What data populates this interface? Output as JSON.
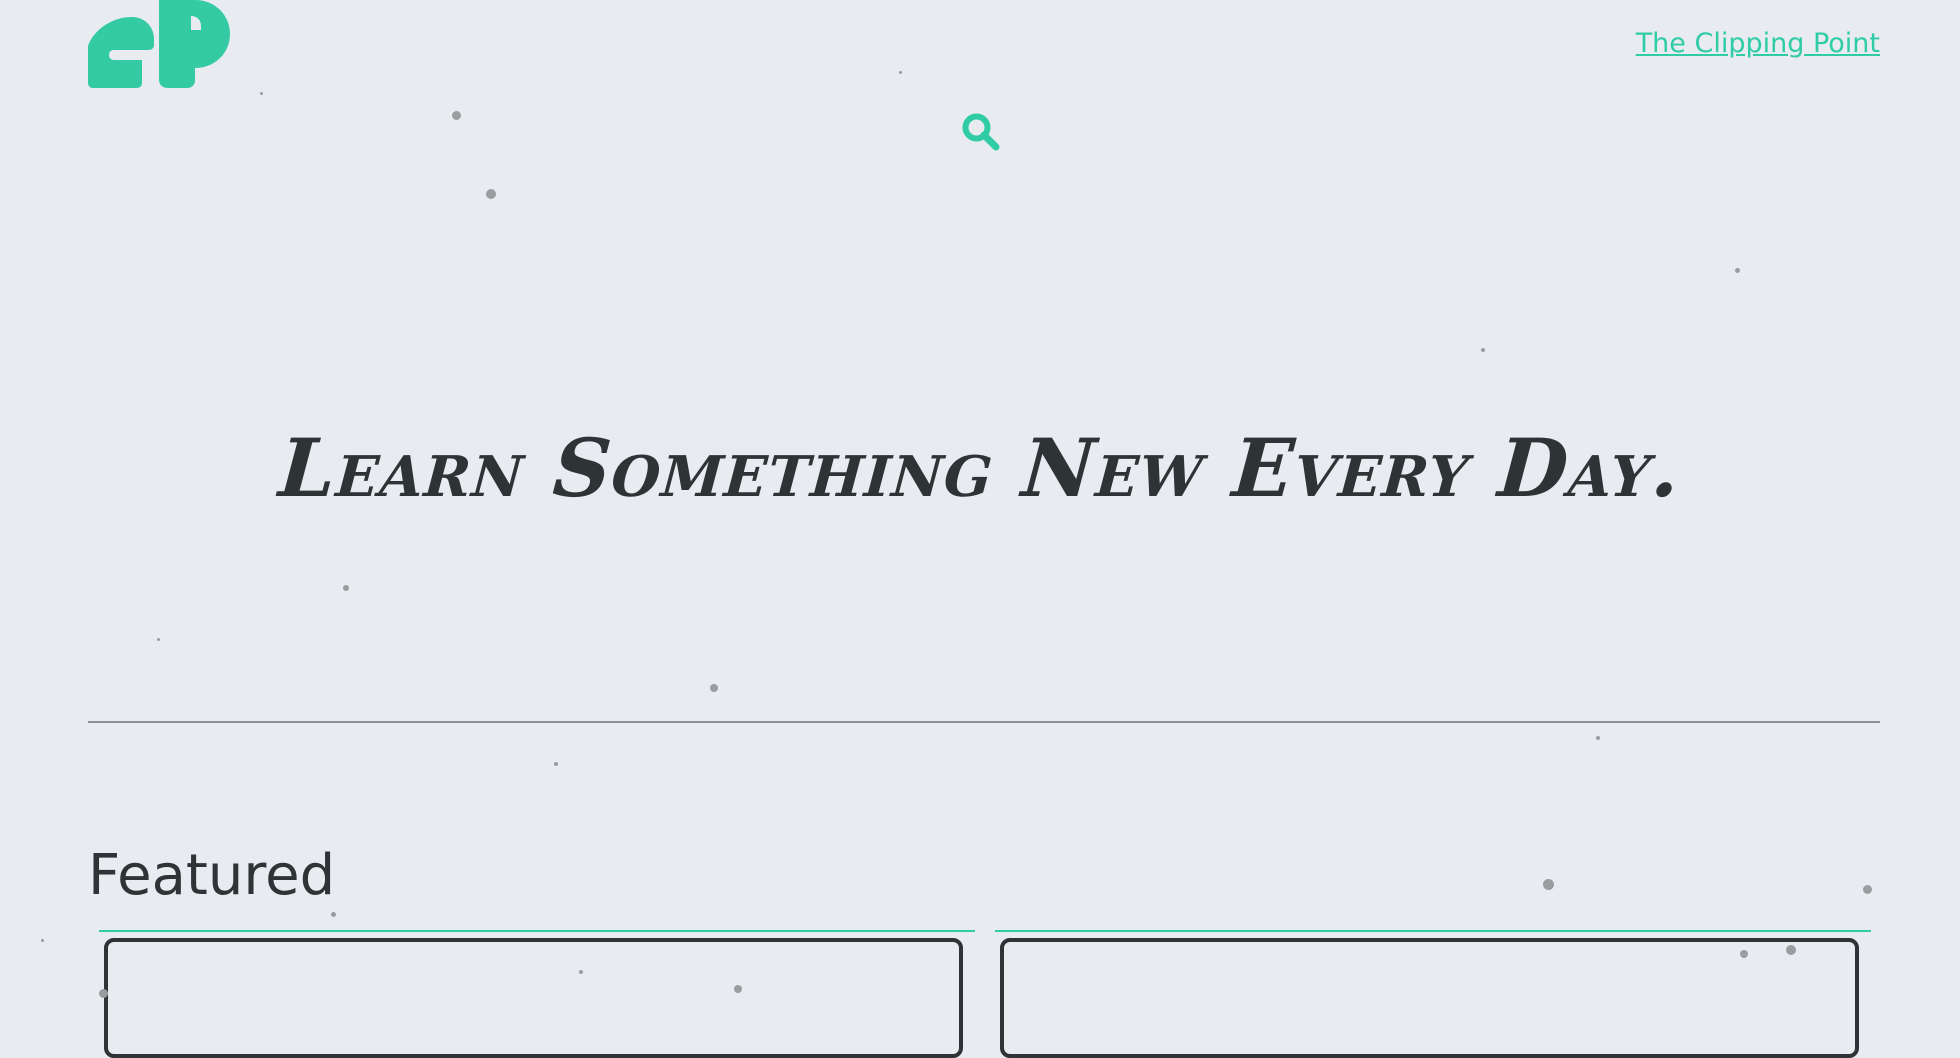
{
  "site": {
    "logo_name": "cP logo",
    "nav_link": "The Clipping Point"
  },
  "hero": {
    "title": "Learn Something New Every Day."
  },
  "featured": {
    "heading": "Featured"
  },
  "colors": {
    "accent": "#2fcca5",
    "text": "#2e3336",
    "background": "#e8ebf0"
  },
  "icons": {
    "search": "search-icon"
  }
}
